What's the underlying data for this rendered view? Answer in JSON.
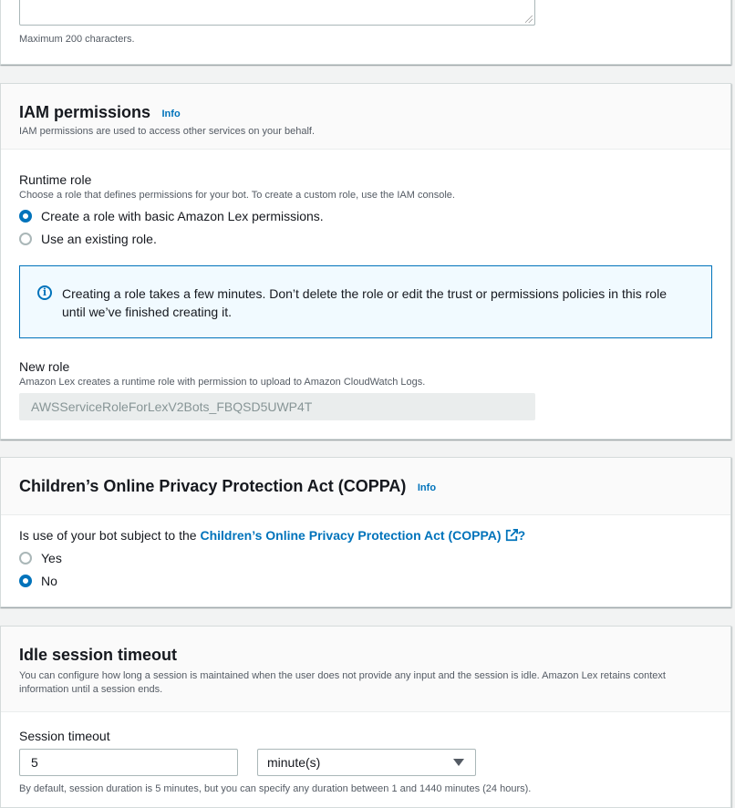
{
  "description_hint": "Maximum 200 characters.",
  "iam": {
    "title": "IAM permissions",
    "info_label": "Info",
    "description": "IAM permissions are used to access other services on your behalf.",
    "runtime_role_label": "Runtime role",
    "runtime_role_description": "Choose a role that defines permissions for your bot. To create a custom role, use the IAM console.",
    "options": [
      {
        "label": "Create a role with basic Amazon Lex permissions.",
        "selected": true
      },
      {
        "label": "Use an existing role.",
        "selected": false
      }
    ],
    "alert_text": "Creating a role takes a few minutes. Don’t delete the role or edit the trust or permissions policies in this role until we’ve finished creating it.",
    "new_role_label": "New role",
    "new_role_description": "Amazon Lex creates a runtime role with permission to upload to Amazon CloudWatch Logs.",
    "new_role_value": "AWSServiceRoleForLexV2Bots_FBQSD5UWP4T"
  },
  "coppa": {
    "title": "Children’s Online Privacy Protection Act (COPPA)",
    "info_label": "Info",
    "question_prefix": "Is use of your bot subject to the ",
    "question_link": "Children’s Online Privacy Protection Act (COPPA)",
    "question_suffix": "?",
    "options": [
      {
        "label": "Yes",
        "selected": false
      },
      {
        "label": "No",
        "selected": true
      }
    ]
  },
  "idle": {
    "title": "Idle session timeout",
    "description": "You can configure how long a session is maintained when the user does not provide any input and the session is idle. Amazon Lex retains context information until a session ends.",
    "session_timeout_label": "Session timeout",
    "timeout_value": "5",
    "unit_value": "minute(s)",
    "hint": "By default, session duration is 5 minutes, but you can specify any duration between 1 and 1440 minutes (24 hours)."
  },
  "colors": {
    "accent": "#0073bb",
    "background": "#f2f3f3",
    "alert_bg": "#f1faff"
  }
}
